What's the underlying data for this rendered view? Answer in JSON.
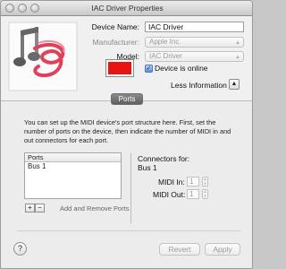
{
  "window": {
    "title": "IAC Driver Properties"
  },
  "device": {
    "name_label": "Device Name:",
    "name_value": "IAC Driver",
    "manufacturer_label": "Manufacturer:",
    "manufacturer_value": "Apple Inc.",
    "model_label": "Model:",
    "model_value": "IAC Driver",
    "online_label": "Device is online",
    "online_checked": true,
    "less_info_label": "Less Information",
    "color": "#e8140f"
  },
  "tabs": {
    "ports_label": "Ports"
  },
  "ports": {
    "description": "You can set up the MIDI device's port structure here.  First, set the number of ports on the device, then indicate the number of MIDI in and out connectors for each port.",
    "table_header": "Ports",
    "rows": [
      "Bus 1"
    ],
    "add_label": "+",
    "remove_label": "−",
    "add_remove_hint": "Add and Remove Ports",
    "connectors_title": "Connectors for:",
    "selected_port": "Bus 1",
    "midi_in_label": "MIDI In:",
    "midi_in_value": "1",
    "midi_out_label": "MIDI Out:",
    "midi_out_value": "1"
  },
  "footer": {
    "help_label": "?",
    "revert_label": "Revert",
    "apply_label": "Apply"
  }
}
